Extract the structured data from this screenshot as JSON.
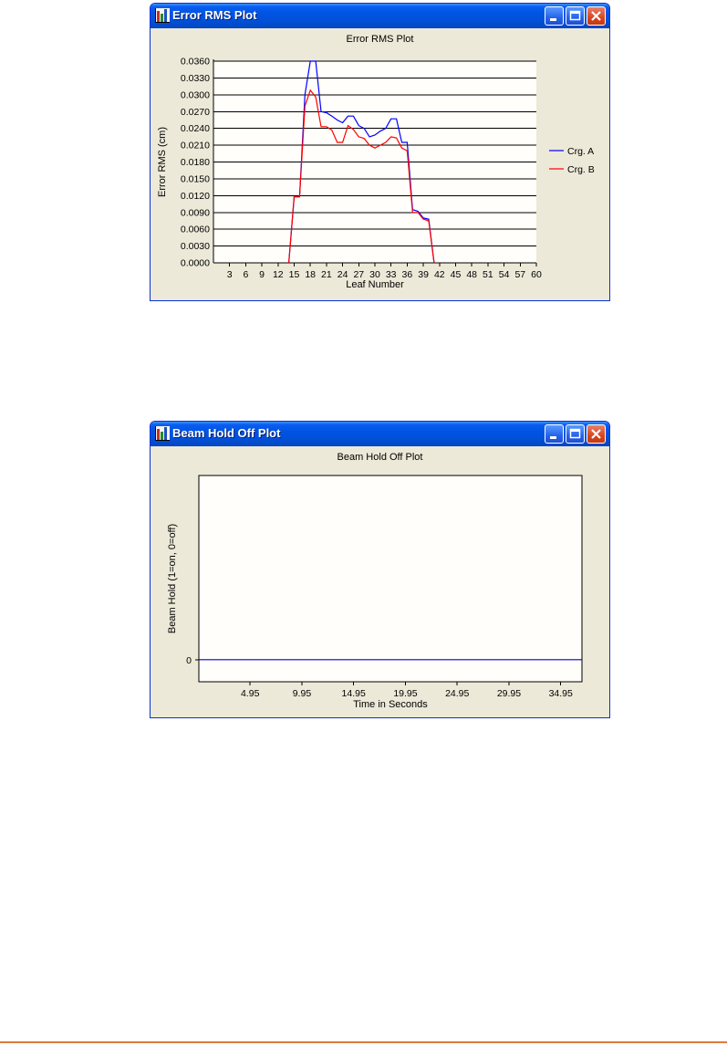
{
  "windows": {
    "error_rms": {
      "title": "Error RMS Plot",
      "chart_title": "Error RMS Plot"
    },
    "beam_hold": {
      "title": "Beam Hold Off Plot",
      "chart_title": "Beam Hold Off Plot"
    }
  },
  "chart_data": [
    {
      "type": "line",
      "title": "Error RMS Plot",
      "xlabel": "Leaf Number",
      "ylabel": "Error RMS (cm)",
      "xlim": [
        0,
        60
      ],
      "ylim": [
        0,
        0.036
      ],
      "x_ticks": [
        "3",
        "6",
        "9",
        "12",
        "15",
        "18",
        "21",
        "24",
        "27",
        "30",
        "33",
        "36",
        "39",
        "42",
        "45",
        "48",
        "51",
        "54",
        "57",
        "60"
      ],
      "y_ticks": [
        "0.0000",
        "0.0030",
        "0.0060",
        "0.0090",
        "0.0120",
        "0.0150",
        "0.0180",
        "0.0210",
        "0.0240",
        "0.0270",
        "0.0300",
        "0.0330",
        "0.0360"
      ],
      "grid": true,
      "legend_position": "right",
      "series": [
        {
          "name": "Crg. A",
          "color": "#0000ff",
          "points": [
            [
              14,
              0
            ],
            [
              15,
              0.0118
            ],
            [
              16,
              0.0118
            ],
            [
              17,
              0.03
            ],
            [
              18,
              0.036
            ],
            [
              19,
              0.036
            ],
            [
              20,
              0.027
            ],
            [
              21,
              0.0268
            ],
            [
              22,
              0.0262
            ],
            [
              23,
              0.0255
            ],
            [
              24,
              0.025
            ],
            [
              25,
              0.0262
            ],
            [
              26,
              0.0262
            ],
            [
              27,
              0.0245
            ],
            [
              28,
              0.024
            ],
            [
              29,
              0.0225
            ],
            [
              30,
              0.0228
            ],
            [
              31,
              0.0235
            ],
            [
              32,
              0.024
            ],
            [
              33,
              0.0257
            ],
            [
              34,
              0.0257
            ],
            [
              35,
              0.0215
            ],
            [
              36,
              0.0215
            ],
            [
              37,
              0.0095
            ],
            [
              38,
              0.0092
            ],
            [
              39,
              0.008
            ],
            [
              40,
              0.0078
            ],
            [
              41,
              0
            ]
          ]
        },
        {
          "name": "Crg. B",
          "color": "#ff0000",
          "points": [
            [
              14,
              0
            ],
            [
              15,
              0.0118
            ],
            [
              16,
              0.0118
            ],
            [
              17,
              0.028
            ],
            [
              18,
              0.0308
            ],
            [
              19,
              0.0296
            ],
            [
              20,
              0.0243
            ],
            [
              21,
              0.0243
            ],
            [
              22,
              0.0237
            ],
            [
              23,
              0.0215
            ],
            [
              24,
              0.0215
            ],
            [
              25,
              0.0245
            ],
            [
              26,
              0.0238
            ],
            [
              27,
              0.0225
            ],
            [
              28,
              0.0222
            ],
            [
              29,
              0.021
            ],
            [
              30,
              0.0205
            ],
            [
              31,
              0.021
            ],
            [
              32,
              0.0215
            ],
            [
              33,
              0.0225
            ],
            [
              34,
              0.0223
            ],
            [
              35,
              0.0205
            ],
            [
              36,
              0.02
            ],
            [
              37,
              0.009
            ],
            [
              38,
              0.009
            ],
            [
              39,
              0.0078
            ],
            [
              40,
              0.0075
            ],
            [
              41,
              0
            ]
          ]
        }
      ]
    },
    {
      "type": "line",
      "title": "Beam Hold Off Plot",
      "xlabel": "Time in Seconds",
      "ylabel": "Beam Hold (1=on, 0=off)",
      "xlim": [
        0,
        37
      ],
      "ylim": [
        -0.12,
        1
      ],
      "x_ticks": [
        "4.95",
        "9.95",
        "14.95",
        "19.95",
        "24.95",
        "29.95",
        "34.95"
      ],
      "y_ticks": [
        "0"
      ],
      "grid": false,
      "series": [
        {
          "color": "#0000cc",
          "points": [
            [
              0,
              0
            ],
            [
              37,
              0
            ]
          ]
        }
      ]
    }
  ]
}
